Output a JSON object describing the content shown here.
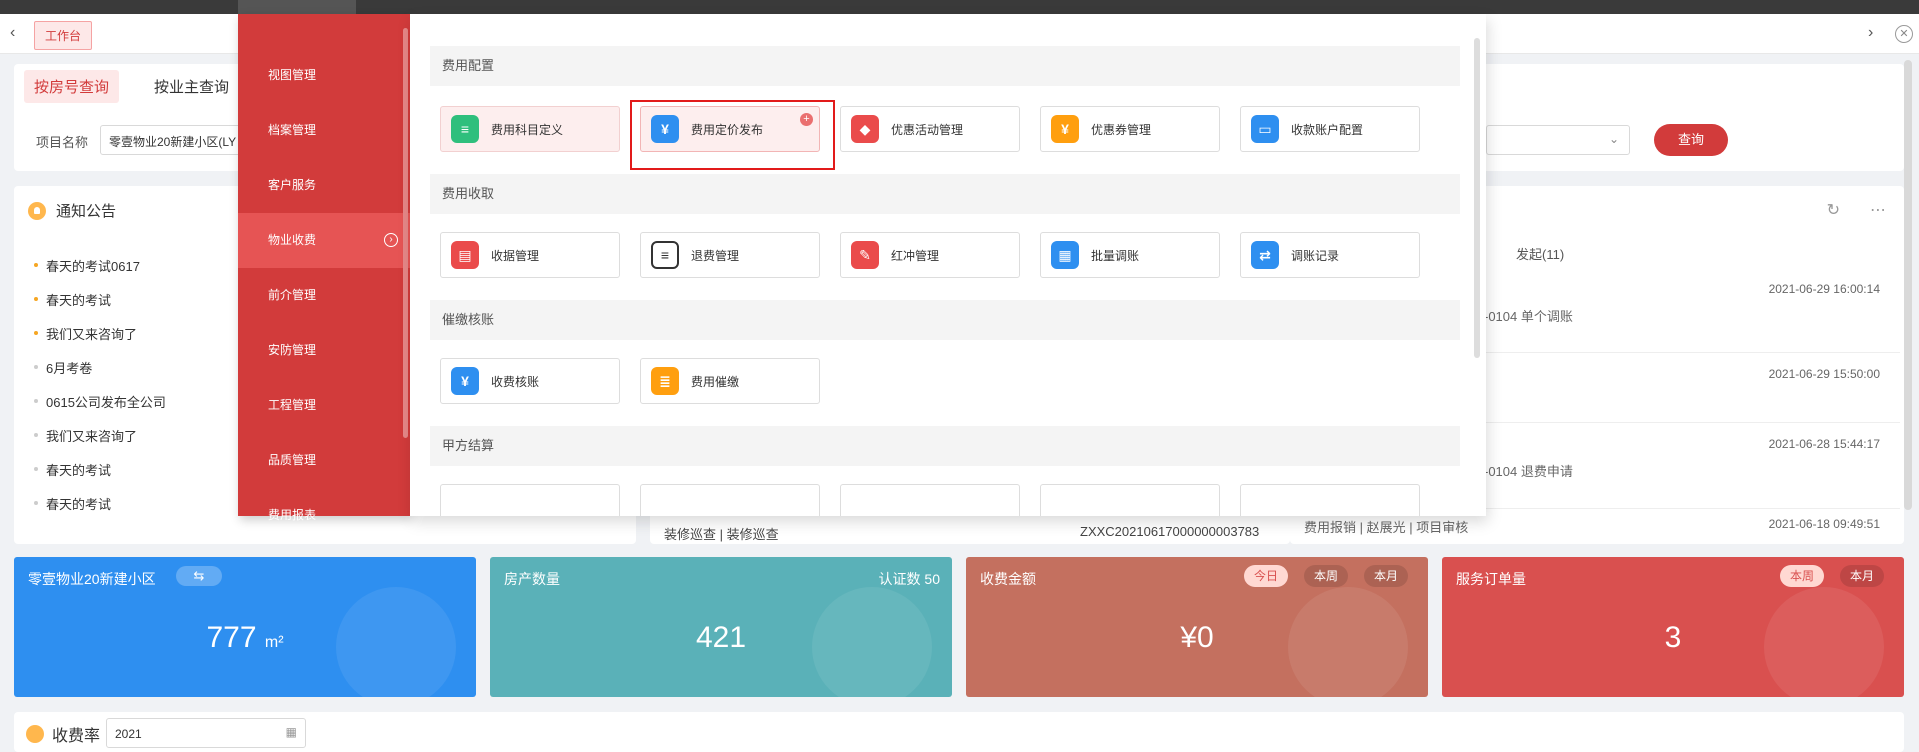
{
  "tabs": {
    "workbench": "工作台"
  },
  "query": {
    "tab_room": "按房号查询",
    "tab_owner": "按业主查询",
    "project_label": "项目名称",
    "project_value": "零壹物业20新建小区(LY",
    "submit": "查询"
  },
  "notice": {
    "title": "通知公告",
    "items": [
      "春天的考试0617",
      "春天的考试",
      "我们又来咨询了",
      "6月考卷",
      "0615公司发布全公司",
      "我们又来咨询了",
      "春天的考试",
      "春天的考试"
    ]
  },
  "middle": {
    "row_left": "装修巡查 | 装修巡查",
    "row_code": "ZXXC20210617000000003783"
  },
  "right": {
    "tab_label": "发起(11)",
    "items": [
      {
        "date": "2021-06-29 16:00:14",
        "text": "-0104 单个调账"
      },
      {
        "date": "2021-06-29 15:50:00",
        "text": ""
      },
      {
        "date": "2021-06-28 15:44:17",
        "text": "-0104 退费申请"
      },
      {
        "date": "2021-06-18 09:49:51",
        "text": "费用报销 | 赵展光 | 项目审核"
      }
    ]
  },
  "stats": {
    "community": {
      "title": "零壹物业20新建小区",
      "value": "777",
      "unit": "m²",
      "swap": "⇆"
    },
    "houses": {
      "title": "房产数量",
      "cert": "认证数 50",
      "value": "421"
    },
    "fee": {
      "title": "收费金额",
      "value": "¥0",
      "today": "今日",
      "week": "本周",
      "month": "本月"
    },
    "orders": {
      "title": "服务订单量",
      "value": "3",
      "week": "本周",
      "month": "本月"
    }
  },
  "rate": {
    "title": "收费率",
    "year": "2021"
  },
  "menu": {
    "left": [
      "视图管理",
      "档案管理",
      "客户服务",
      "物业收费",
      "前介管理",
      "安防管理",
      "工程管理",
      "品质管理",
      "费用报表"
    ],
    "active_index": 3,
    "sections": [
      {
        "title": "费用配置",
        "tiles": [
          {
            "label": "费用科目定义",
            "color": "green",
            "icon": "list-icon"
          },
          {
            "label": "费用定价发布",
            "color": "blue",
            "icon": "price-icon"
          },
          {
            "label": "优惠活动管理",
            "color": "red",
            "icon": "tag-icon"
          },
          {
            "label": "优惠券管理",
            "color": "orange",
            "icon": "coupon-icon"
          },
          {
            "label": "收款账户配置",
            "color": "blue",
            "icon": "card-icon"
          }
        ]
      },
      {
        "title": "费用收取",
        "tiles": [
          {
            "label": "收据管理",
            "color": "red",
            "icon": "receipt-icon"
          },
          {
            "label": "退费管理",
            "color": "gray",
            "icon": "refund-icon"
          },
          {
            "label": "红冲管理",
            "color": "red",
            "icon": "edit-icon"
          },
          {
            "label": "批量调账",
            "color": "blue",
            "icon": "batch-icon"
          },
          {
            "label": "调账记录",
            "color": "blue",
            "icon": "record-icon"
          }
        ]
      },
      {
        "title": "催缴核账",
        "tiles": [
          {
            "label": "收费核账",
            "color": "blue",
            "icon": "yen-icon"
          },
          {
            "label": "费用催缴",
            "color": "orange",
            "icon": "remind-icon"
          }
        ]
      },
      {
        "title": "甲方结算",
        "tiles": []
      }
    ]
  }
}
